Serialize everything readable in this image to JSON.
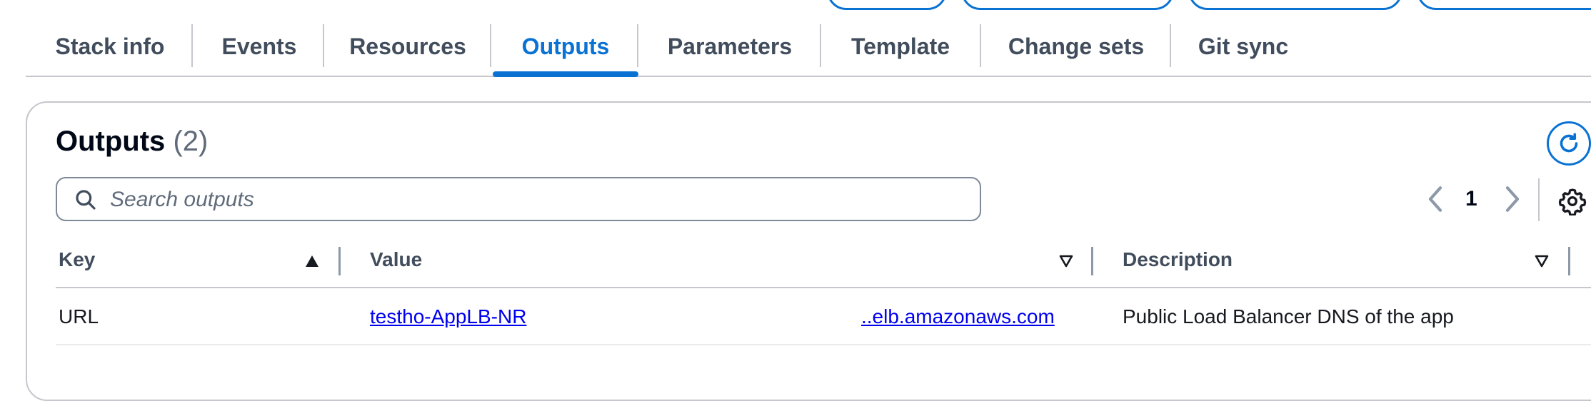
{
  "tabs": [
    {
      "label": "Stack info"
    },
    {
      "label": "Events"
    },
    {
      "label": "Resources"
    },
    {
      "label": "Outputs",
      "active": true
    },
    {
      "label": "Parameters"
    },
    {
      "label": "Template"
    },
    {
      "label": "Change sets"
    },
    {
      "label": "Git sync"
    }
  ],
  "outputs": {
    "title": "Outputs",
    "count": "(2)",
    "search_placeholder": "Search outputs",
    "page": "1",
    "columns": {
      "key": "Key",
      "value": "Value",
      "description": "Description"
    },
    "rows": [
      {
        "key": "URL",
        "value_start": "testho-AppLB-NR",
        "value_end": "..elb.amazonaws.com",
        "description": "Public Load Balancer DNS of the app"
      }
    ]
  },
  "colors": {
    "accent": "#0972d3",
    "link": "#0000ee",
    "text": "#16191f",
    "muted": "#414d5c"
  },
  "icons": [
    "refresh-icon",
    "search-icon",
    "chevron-left-icon",
    "chevron-right-icon",
    "settings-icon",
    "sort-ascending-icon",
    "sort-descending-icon"
  ]
}
